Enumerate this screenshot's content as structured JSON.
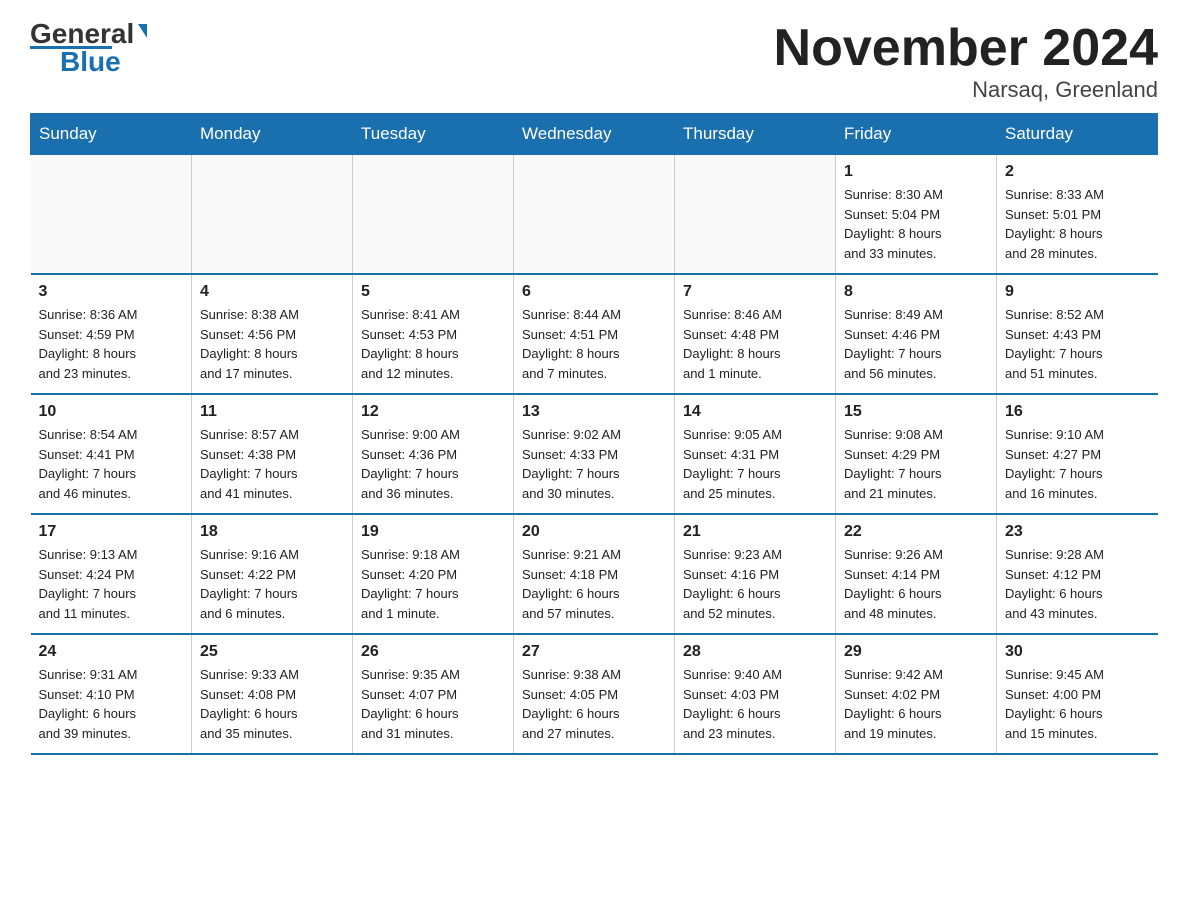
{
  "logo": {
    "general": "General",
    "blue": "Blue"
  },
  "title": "November 2024",
  "subtitle": "Narsaq, Greenland",
  "days_of_week": [
    "Sunday",
    "Monday",
    "Tuesday",
    "Wednesday",
    "Thursday",
    "Friday",
    "Saturday"
  ],
  "weeks": [
    [
      {
        "day": "",
        "info": ""
      },
      {
        "day": "",
        "info": ""
      },
      {
        "day": "",
        "info": ""
      },
      {
        "day": "",
        "info": ""
      },
      {
        "day": "",
        "info": ""
      },
      {
        "day": "1",
        "info": "Sunrise: 8:30 AM\nSunset: 5:04 PM\nDaylight: 8 hours\nand 33 minutes."
      },
      {
        "day": "2",
        "info": "Sunrise: 8:33 AM\nSunset: 5:01 PM\nDaylight: 8 hours\nand 28 minutes."
      }
    ],
    [
      {
        "day": "3",
        "info": "Sunrise: 8:36 AM\nSunset: 4:59 PM\nDaylight: 8 hours\nand 23 minutes."
      },
      {
        "day": "4",
        "info": "Sunrise: 8:38 AM\nSunset: 4:56 PM\nDaylight: 8 hours\nand 17 minutes."
      },
      {
        "day": "5",
        "info": "Sunrise: 8:41 AM\nSunset: 4:53 PM\nDaylight: 8 hours\nand 12 minutes."
      },
      {
        "day": "6",
        "info": "Sunrise: 8:44 AM\nSunset: 4:51 PM\nDaylight: 8 hours\nand 7 minutes."
      },
      {
        "day": "7",
        "info": "Sunrise: 8:46 AM\nSunset: 4:48 PM\nDaylight: 8 hours\nand 1 minute."
      },
      {
        "day": "8",
        "info": "Sunrise: 8:49 AM\nSunset: 4:46 PM\nDaylight: 7 hours\nand 56 minutes."
      },
      {
        "day": "9",
        "info": "Sunrise: 8:52 AM\nSunset: 4:43 PM\nDaylight: 7 hours\nand 51 minutes."
      }
    ],
    [
      {
        "day": "10",
        "info": "Sunrise: 8:54 AM\nSunset: 4:41 PM\nDaylight: 7 hours\nand 46 minutes."
      },
      {
        "day": "11",
        "info": "Sunrise: 8:57 AM\nSunset: 4:38 PM\nDaylight: 7 hours\nand 41 minutes."
      },
      {
        "day": "12",
        "info": "Sunrise: 9:00 AM\nSunset: 4:36 PM\nDaylight: 7 hours\nand 36 minutes."
      },
      {
        "day": "13",
        "info": "Sunrise: 9:02 AM\nSunset: 4:33 PM\nDaylight: 7 hours\nand 30 minutes."
      },
      {
        "day": "14",
        "info": "Sunrise: 9:05 AM\nSunset: 4:31 PM\nDaylight: 7 hours\nand 25 minutes."
      },
      {
        "day": "15",
        "info": "Sunrise: 9:08 AM\nSunset: 4:29 PM\nDaylight: 7 hours\nand 21 minutes."
      },
      {
        "day": "16",
        "info": "Sunrise: 9:10 AM\nSunset: 4:27 PM\nDaylight: 7 hours\nand 16 minutes."
      }
    ],
    [
      {
        "day": "17",
        "info": "Sunrise: 9:13 AM\nSunset: 4:24 PM\nDaylight: 7 hours\nand 11 minutes."
      },
      {
        "day": "18",
        "info": "Sunrise: 9:16 AM\nSunset: 4:22 PM\nDaylight: 7 hours\nand 6 minutes."
      },
      {
        "day": "19",
        "info": "Sunrise: 9:18 AM\nSunset: 4:20 PM\nDaylight: 7 hours\nand 1 minute."
      },
      {
        "day": "20",
        "info": "Sunrise: 9:21 AM\nSunset: 4:18 PM\nDaylight: 6 hours\nand 57 minutes."
      },
      {
        "day": "21",
        "info": "Sunrise: 9:23 AM\nSunset: 4:16 PM\nDaylight: 6 hours\nand 52 minutes."
      },
      {
        "day": "22",
        "info": "Sunrise: 9:26 AM\nSunset: 4:14 PM\nDaylight: 6 hours\nand 48 minutes."
      },
      {
        "day": "23",
        "info": "Sunrise: 9:28 AM\nSunset: 4:12 PM\nDaylight: 6 hours\nand 43 minutes."
      }
    ],
    [
      {
        "day": "24",
        "info": "Sunrise: 9:31 AM\nSunset: 4:10 PM\nDaylight: 6 hours\nand 39 minutes."
      },
      {
        "day": "25",
        "info": "Sunrise: 9:33 AM\nSunset: 4:08 PM\nDaylight: 6 hours\nand 35 minutes."
      },
      {
        "day": "26",
        "info": "Sunrise: 9:35 AM\nSunset: 4:07 PM\nDaylight: 6 hours\nand 31 minutes."
      },
      {
        "day": "27",
        "info": "Sunrise: 9:38 AM\nSunset: 4:05 PM\nDaylight: 6 hours\nand 27 minutes."
      },
      {
        "day": "28",
        "info": "Sunrise: 9:40 AM\nSunset: 4:03 PM\nDaylight: 6 hours\nand 23 minutes."
      },
      {
        "day": "29",
        "info": "Sunrise: 9:42 AM\nSunset: 4:02 PM\nDaylight: 6 hours\nand 19 minutes."
      },
      {
        "day": "30",
        "info": "Sunrise: 9:45 AM\nSunset: 4:00 PM\nDaylight: 6 hours\nand 15 minutes."
      }
    ]
  ]
}
